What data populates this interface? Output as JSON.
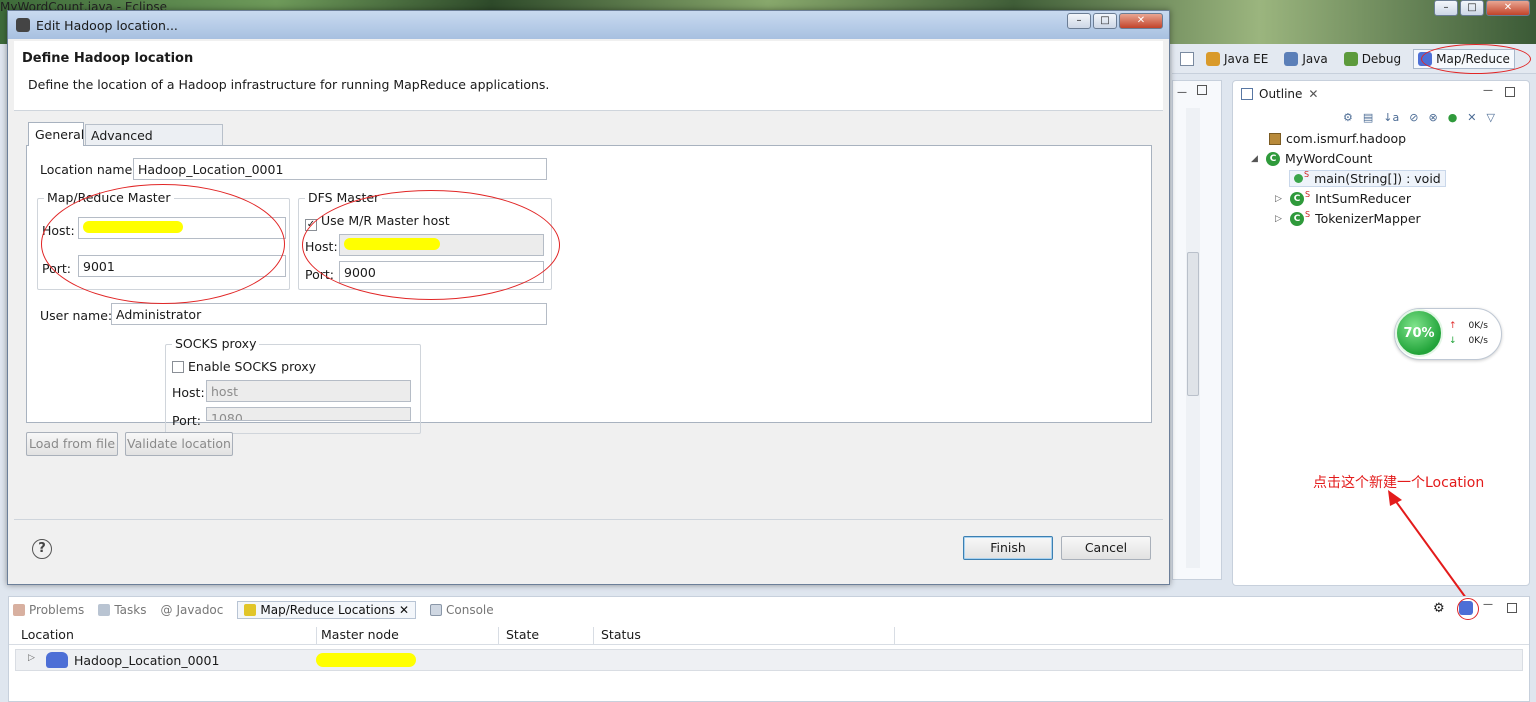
{
  "background_window": {
    "title": "MyWordCount.java - Eclipse"
  },
  "perspectives": [
    {
      "label": "Java EE"
    },
    {
      "label": "Java"
    },
    {
      "label": "Debug"
    },
    {
      "label": "Map/Reduce",
      "active": true
    }
  ],
  "outline": {
    "tab_label": "Outline",
    "items": [
      {
        "label": "com.ismurf.hadoop",
        "icon": "package-icon"
      },
      {
        "label": "MyWordCount",
        "icon": "class-icon"
      },
      {
        "label": "main(String[]) : void",
        "icon": "method-icon",
        "selected": true
      },
      {
        "label": "IntSumReducer",
        "icon": "class-icon"
      },
      {
        "label": "TokenizerMapper",
        "icon": "class-icon"
      }
    ]
  },
  "network_widget": {
    "percent": "70%",
    "up": "0K/s",
    "down": "0K/s"
  },
  "annotation": {
    "text": "点击这个新建一个Location",
    "color": "#e31b1b"
  },
  "bottom_view": {
    "tabs": [
      {
        "label": "Problems"
      },
      {
        "label": "Tasks"
      },
      {
        "label": "Javadoc"
      },
      {
        "label": "Map/Reduce Locations",
        "active": true
      },
      {
        "label": "Console"
      }
    ],
    "columns": [
      "Location",
      "Master node",
      "State",
      "Status"
    ],
    "rows": [
      {
        "location": "Hadoop_Location_0001",
        "master_node": "",
        "state": "",
        "status": ""
      }
    ]
  },
  "dialog": {
    "title": "Edit Hadoop location...",
    "header_title": "Define Hadoop location",
    "header_desc": "Define the location of a Hadoop infrastructure for running MapReduce applications.",
    "tabs": [
      {
        "label": "General",
        "active": true
      },
      {
        "label": "Advanced parameters"
      }
    ],
    "location_name_label": "Location name:",
    "location_name_value": "Hadoop_Location_0001",
    "mr_master": {
      "title": "Map/Reduce Master",
      "host_label": "Host:",
      "host_value": "",
      "port_label": "Port:",
      "port_value": "9001"
    },
    "dfs_master": {
      "title": "DFS Master",
      "use_mr_host_label": "Use M/R Master host",
      "use_mr_host_checked": true,
      "host_label": "Host:",
      "host_value": "",
      "port_label": "Port:",
      "port_value": "9000"
    },
    "user_name_label": "User name:",
    "user_name_value": "Administrator",
    "socks": {
      "title": "SOCKS proxy",
      "enable_label": "Enable SOCKS proxy",
      "enable_checked": false,
      "host_label": "Host:",
      "host_value": "host",
      "port_label": "Port:",
      "port_value": "1080"
    },
    "buttons": {
      "load_from_file": "Load from file",
      "validate_location": "Validate location",
      "finish": "Finish",
      "cancel": "Cancel"
    },
    "help_icon": "help-icon"
  },
  "colors": {
    "annotation_red": "#e12626",
    "highlight_yellow": "#ffff00",
    "active_status_green": "#22a43a"
  }
}
